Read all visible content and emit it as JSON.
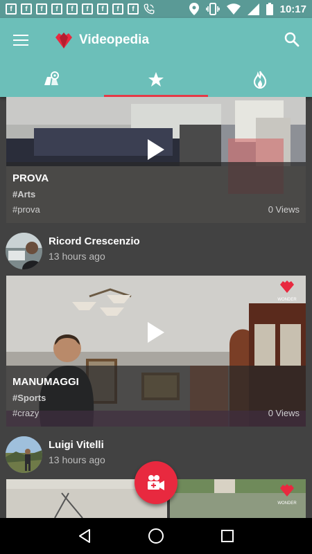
{
  "status_bar": {
    "time": "10:17",
    "notification_icons": [
      "f-icon",
      "f-icon",
      "f-icon",
      "f-icon",
      "f-icon",
      "f-icon",
      "f-icon",
      "f-icon",
      "f-icon",
      "phone-icon"
    ],
    "system_icons": [
      "location-icon",
      "vibrate-icon",
      "wifi-icon",
      "signal-icon",
      "battery-icon"
    ]
  },
  "app_bar": {
    "title": "Videopedia",
    "tabs": [
      {
        "icon": "nearby-icon",
        "active": false
      },
      {
        "icon": "star-icon",
        "active": true
      },
      {
        "icon": "flame-icon",
        "active": false
      }
    ]
  },
  "feed": {
    "items": [
      {
        "title": "PROVA",
        "category": "#Arts",
        "tag": "#prova",
        "views": "0 Views"
      },
      {
        "user": "Ricord Crescenzio",
        "time": "13 hours ago",
        "title": "MANUMAGGI",
        "category": "#Sports",
        "tag": "#crazy",
        "views": "0 Views",
        "watermark": "WONDER"
      },
      {
        "user": "Luigi Vitelli",
        "time": "13 hours ago",
        "watermark": "WONDER"
      }
    ]
  },
  "fab": {
    "icon": "video-camera-add-icon"
  },
  "colors": {
    "primary": "#6cbfb9",
    "status_bar": "#5a9a96",
    "accent": "#e8293f",
    "background": "#424242"
  }
}
